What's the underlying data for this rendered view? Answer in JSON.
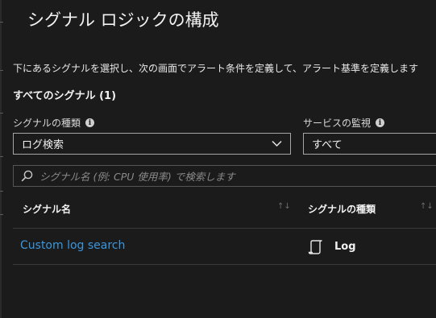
{
  "panel": {
    "title": "シグナル ロジックの構成",
    "description": "下にあるシグナルを選択し、次の画面でアラート条件を定義して、アラート基準を定義します",
    "section_title": "すべてのシグナル (1)"
  },
  "filters": {
    "signal_type_label": "シグナルの種類",
    "signal_type_value": "ログ検索",
    "service_monitor_label": "サービスの監視",
    "service_monitor_value": "すべて"
  },
  "search": {
    "placeholder": "シグナル名 (例: CPU 使用率) で検索します"
  },
  "table": {
    "columns": [
      "シグナル名",
      "シグナルの種類"
    ],
    "rows": [
      {
        "name": "Custom log search",
        "type": "Log"
      }
    ]
  },
  "icons": {
    "info": "info-icon",
    "dropdown": "chevron-down-icon",
    "search": "search-icon",
    "sort": "sort-icon",
    "log": "log-scroll-icon"
  },
  "colors": {
    "background": "#1b1b1b",
    "link": "#3a96dd",
    "text": "#f2f2f2"
  }
}
